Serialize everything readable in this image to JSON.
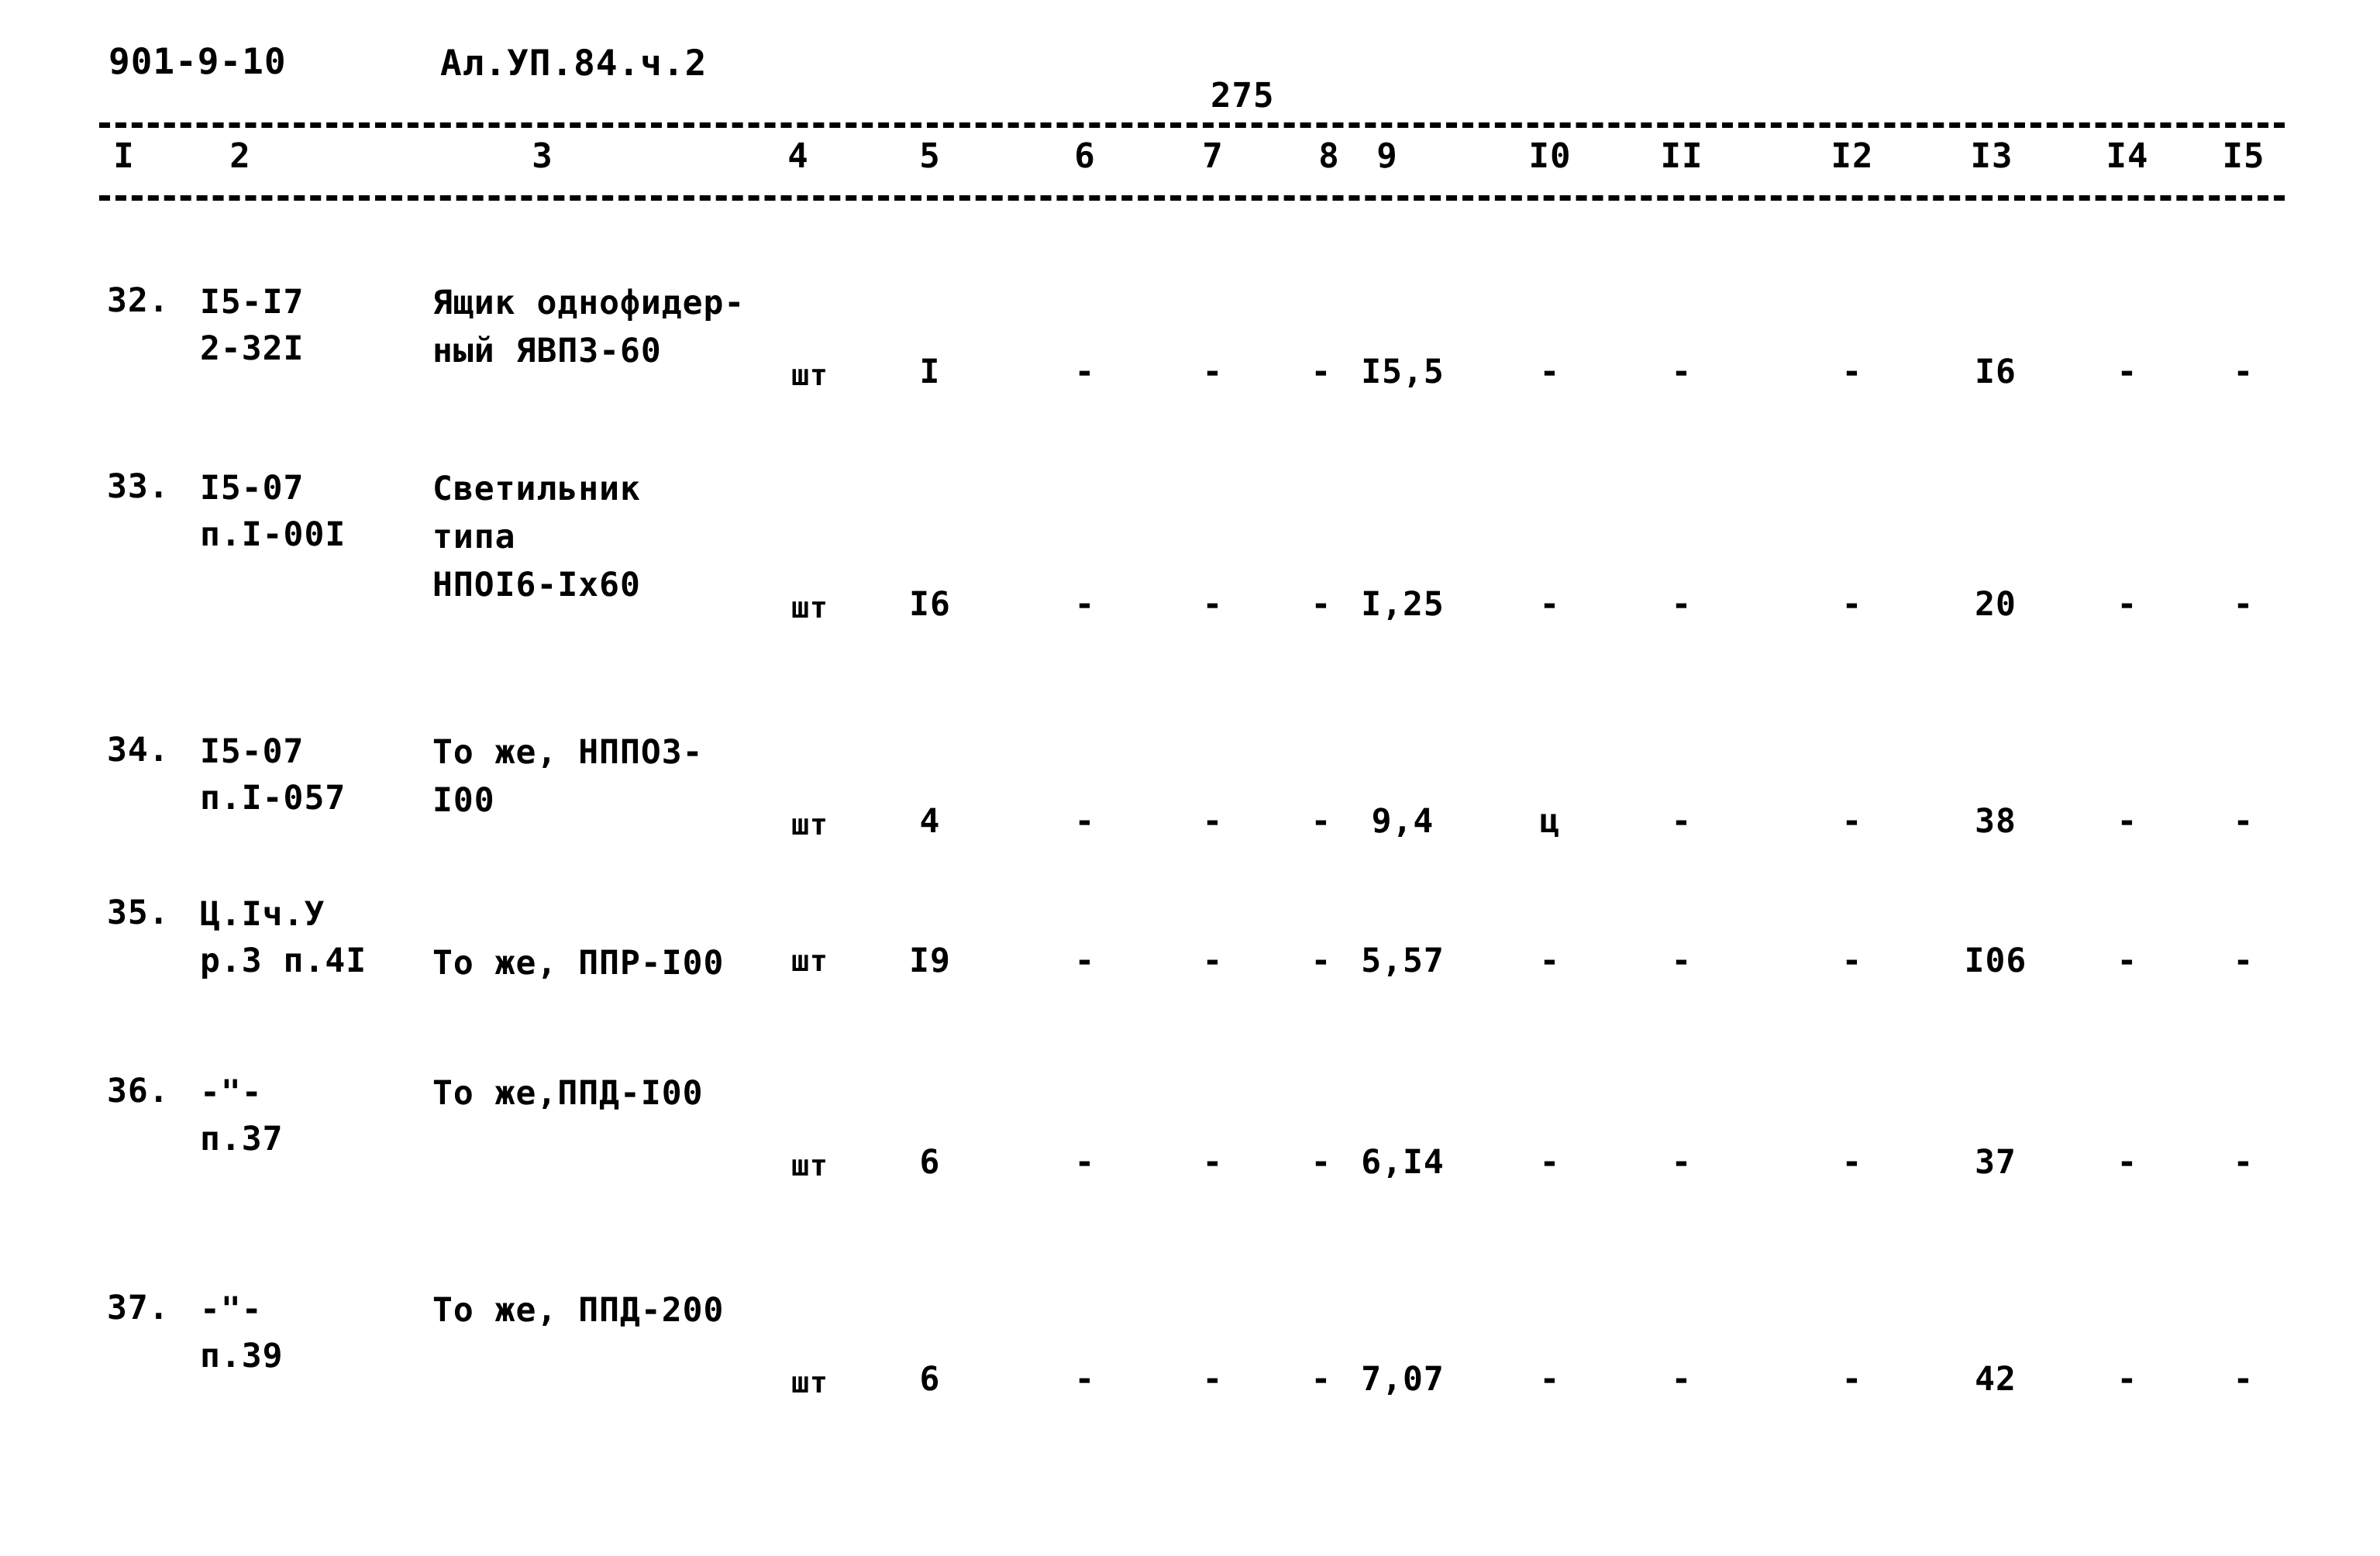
{
  "document": {
    "doc_code": "901-9-10",
    "album_code": "Ал.УП.84.ч.2",
    "page_number": "275"
  },
  "table": {
    "column_headers": [
      "I",
      "2",
      "3",
      "4",
      "5",
      "6",
      "7",
      "8",
      "9",
      "I0",
      "II",
      "I2",
      "I3",
      "I4",
      "I5"
    ],
    "dash": "-",
    "rows": [
      {
        "no": "32.",
        "code_line1": "I5-I7",
        "code_line2": "2-32I",
        "name_line1": "Ящик однофидер-",
        "name_line2": "ный ЯВПЗ-60",
        "name_line3": "",
        "unit": "шт",
        "c5": "I",
        "c6": "-",
        "c7": "-",
        "c8": "-",
        "c9": "I5,5",
        "c10": "-",
        "c11": "-",
        "c12": "-",
        "c13": "I6",
        "c14": "-",
        "c15": "-"
      },
      {
        "no": "33.",
        "code_line1": "I5-07",
        "code_line2": "п.I-00I",
        "name_line1": "Светильник",
        "name_line2": "типа",
        "name_line3": "НПОI6-Iх60",
        "unit": "шт",
        "c5": "I6",
        "c6": "-",
        "c7": "-",
        "c8": "-",
        "c9": "I,25",
        "c10": "-",
        "c11": "-",
        "c12": "-",
        "c13": "20",
        "c14": "-",
        "c15": "-"
      },
      {
        "no": "34.",
        "code_line1": "I5-07",
        "code_line2": "п.I-057",
        "name_line1": "То же, НППО3-",
        "name_line2": "I00",
        "name_line3": "",
        "unit": "шт",
        "c5": "4",
        "c6": "-",
        "c7": "-",
        "c8": "-",
        "c9": "9,4",
        "c10": "ц",
        "c11": "-",
        "c12": "-",
        "c13": "38",
        "c14": "-",
        "c15": "-"
      },
      {
        "no": "35.",
        "code_line1": "Ц.Iч.У",
        "code_line2": "р.3 п.4I",
        "name_line1": "",
        "name_line2": "То же, ППР-I00",
        "name_line3": "",
        "unit": "шт",
        "c5": "I9",
        "c6": "-",
        "c7": "-",
        "c8": "-",
        "c9": "5,57",
        "c10": "-",
        "c11": "-",
        "c12": "-",
        "c13": "I06",
        "c14": "-",
        "c15": "-"
      },
      {
        "no": "36.",
        "code_line1": "-\"-",
        "code_line2": "п.37",
        "name_line1": "То же,ППД-I00",
        "name_line2": "",
        "name_line3": "",
        "unit": "шт",
        "c5": "6",
        "c6": "-",
        "c7": "-",
        "c8": "-",
        "c9": "6,I4",
        "c10": "-",
        "c11": "-",
        "c12": "-",
        "c13": "37",
        "c14": "-",
        "c15": "-"
      },
      {
        "no": "37.",
        "code_line1": "-\"-",
        "code_line2": "п.39",
        "name_line1": "То же, ППД-200",
        "name_line2": "",
        "name_line3": "",
        "unit": "шт",
        "c5": "6",
        "c6": "-",
        "c7": "-",
        "c8": "-",
        "c9": "7,07",
        "c10": "-",
        "c11": "-",
        "c12": "-",
        "c13": "42",
        "c14": "-",
        "c15": "-"
      }
    ]
  }
}
